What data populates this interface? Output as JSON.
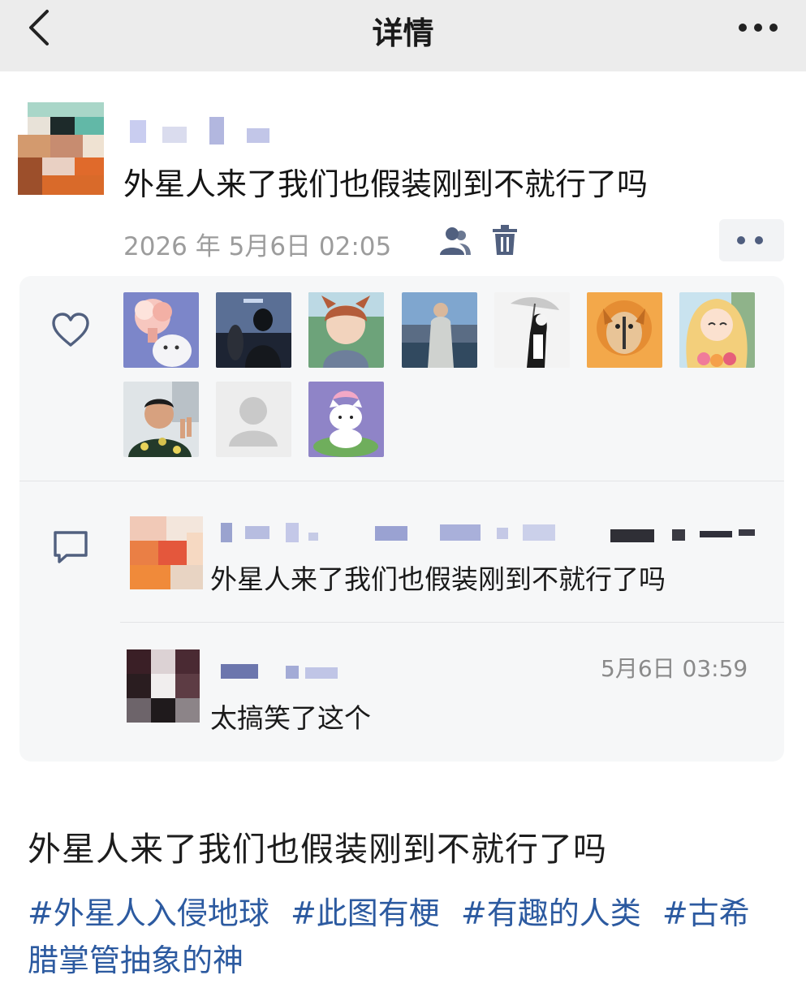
{
  "nav": {
    "title": "详情",
    "back_icon": "chevron-left-icon",
    "more_icon": "more-dots-icon"
  },
  "post": {
    "text": "外星人来了我们也假装刚到不就行了吗",
    "time": "2026 年 5月6日 02:05",
    "icons": [
      "friends-icon",
      "trash-icon"
    ]
  },
  "likes": {
    "icon": "heart-icon",
    "avatars": [
      "cartoon-explosion-cat",
      "dark-figures-night",
      "anime-boy-cat-ears",
      "man-at-lake",
      "anime-girl-umbrella",
      "shiba-dog-orange",
      "anime-girl-blonde",
      "man-peace-sign",
      "default-avatar",
      "hello-kitty-lotus"
    ]
  },
  "comments": [
    {
      "text": "外星人来了我们也假装刚到不就行了吗",
      "time": ""
    },
    {
      "text": "太搞笑了这个",
      "time": "5月6日 03:59"
    }
  ],
  "caption": {
    "text": "外星人来了我们也假装刚到不就行了吗",
    "tags": [
      "#外星人入侵地球",
      "#此图有梗",
      "#有趣的人类",
      "#古希腊掌管抽象的神"
    ]
  },
  "colors": {
    "nav_bg": "#ececec",
    "panel_bg": "#f6f7f8",
    "link": "#2c5aa0",
    "icon": "#4f5d7e"
  }
}
